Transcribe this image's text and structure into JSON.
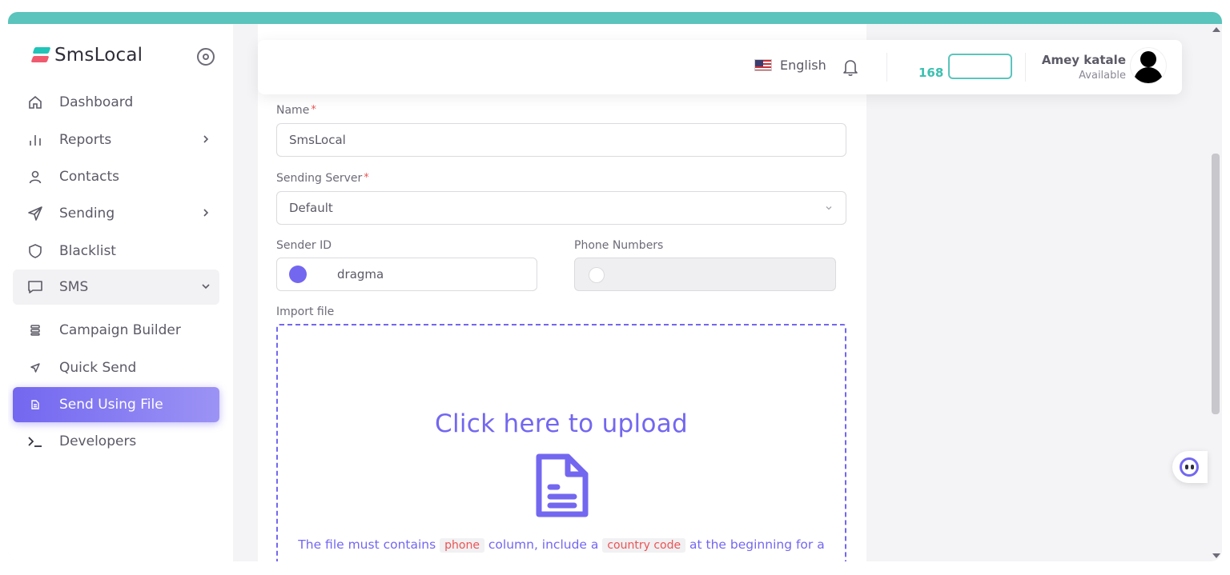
{
  "app": {
    "name": "SmsLocal"
  },
  "colors": {
    "accent": "#7367f0",
    "brand_teal": "#5bc4bc",
    "brand_red": "#f05a6e",
    "required": "#ea5455"
  },
  "sidebar": {
    "items": [
      {
        "label": "Dashboard",
        "icon": "home-icon"
      },
      {
        "label": "Reports",
        "icon": "bar-chart-icon"
      },
      {
        "label": "Contacts",
        "icon": "user-icon"
      },
      {
        "label": "Sending",
        "icon": "send-icon"
      },
      {
        "label": "Blacklist",
        "icon": "shield-icon"
      },
      {
        "label": "SMS",
        "icon": "message-icon"
      }
    ],
    "sms_sub_items": [
      {
        "label": "Campaign Builder",
        "icon": "database-icon"
      },
      {
        "label": "Quick Send",
        "icon": "send-small-icon"
      },
      {
        "label": "Send Using File",
        "icon": "file-icon",
        "active": true
      }
    ],
    "developers": {
      "label": "Developers",
      "icon": "terminal-icon"
    }
  },
  "header": {
    "language": "English",
    "credits_value": "168",
    "user_name": "Amey katale",
    "user_status": "Available"
  },
  "form": {
    "name_label": "Name",
    "name_value": "SmsLocal",
    "server_label": "Sending Server",
    "server_value": "Default",
    "sender_label": "Sender ID",
    "sender_value": "dragma",
    "phone_label": "Phone Numbers",
    "import_label": "Import file",
    "required_mark": "*"
  },
  "dropzone": {
    "title": "Click here to upload",
    "note_part1": "The file must contains",
    "note_code1": "phone",
    "note_part2": "column, include a",
    "note_code2": "country code",
    "note_part3": "at the beginning for a"
  }
}
